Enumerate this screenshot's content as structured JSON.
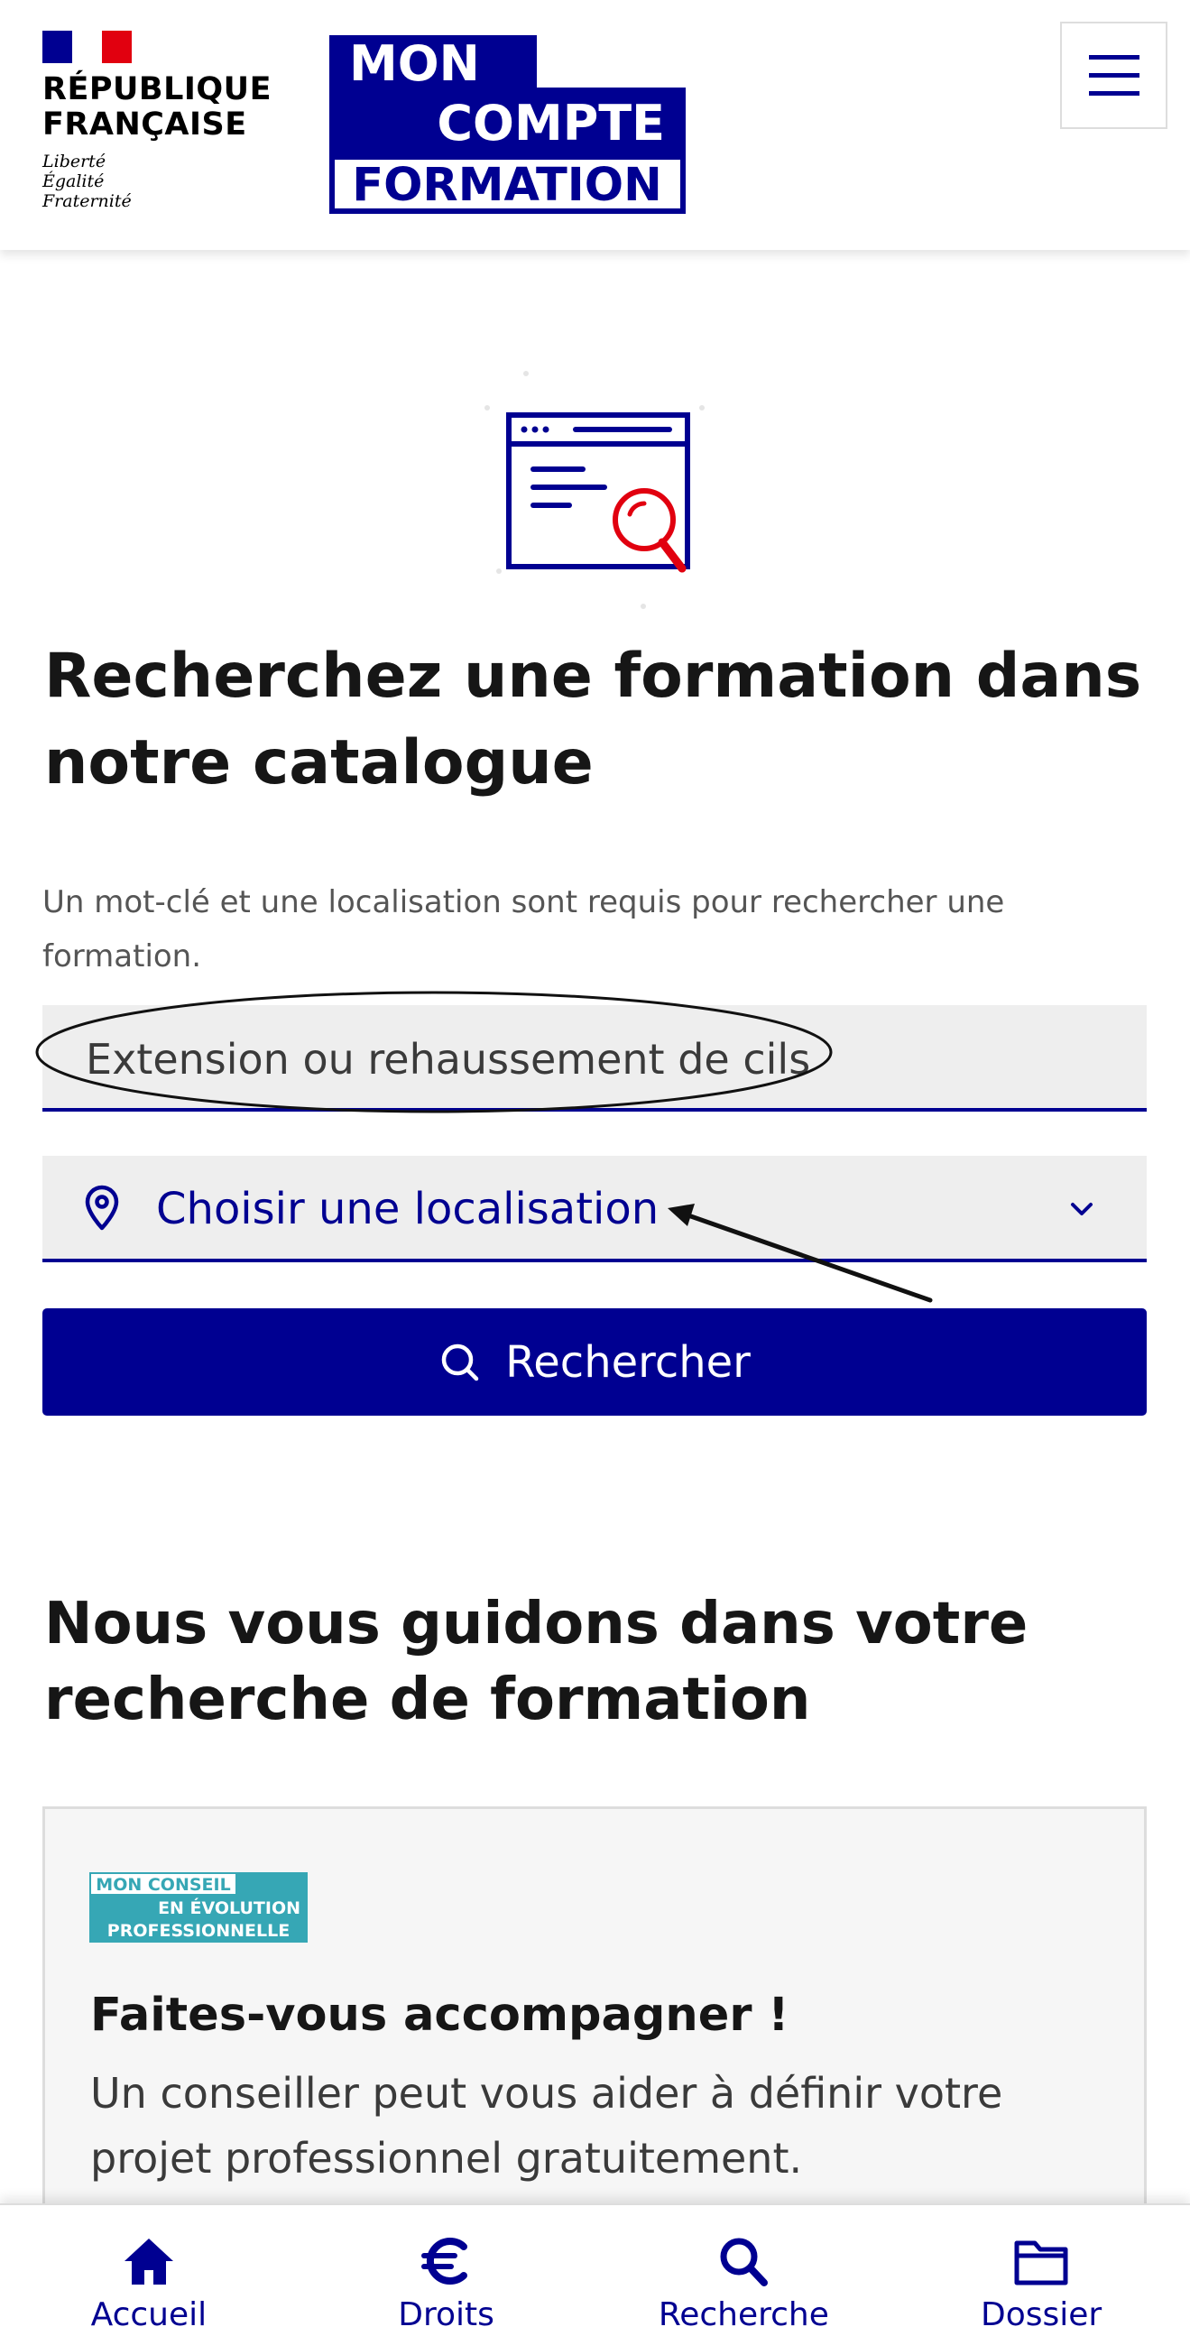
{
  "header": {
    "republic_line1": "RÉPUBLIQUE",
    "republic_line2": "FRANÇAISE",
    "motto_1": "Liberté",
    "motto_2": "Égalité",
    "motto_3": "Fraternité",
    "app_logo_line1": "MON",
    "app_logo_line2": "COMPTE",
    "app_logo_line3": "FORMATION",
    "menu_icon": "hamburger-icon"
  },
  "search": {
    "title": "Recherchez une formation dans notre catalogue",
    "hint": "Un mot-clé et une localisation sont requis pour rechercher une formation.",
    "keyword_value": "Extension ou rehaussement de cils",
    "location_placeholder": "Choisir une localisation",
    "location_icon": "map-pin-icon",
    "dropdown_icon": "chevron-down-icon",
    "button_label": "Rechercher",
    "button_icon": "search-icon"
  },
  "guide": {
    "title": "Nous vous guidons dans votre recherche de formation",
    "card_logo_line1": "MON CONSEIL",
    "card_logo_line2": "EN ÉVOLUTION",
    "card_logo_line3": "PROFESSIONNELLE",
    "card_title": "Faites-vous accompagner !",
    "card_desc": "Un conseiller peut vous aider à définir votre projet professionnel gratuitement."
  },
  "bottom_nav": {
    "items": [
      {
        "label": "Accueil",
        "icon": "home-icon"
      },
      {
        "label": "Droits",
        "icon": "euro-icon"
      },
      {
        "label": "Recherche",
        "icon": "search-icon"
      },
      {
        "label": "Dossier",
        "icon": "folder-icon"
      }
    ]
  },
  "colors": {
    "primary": "#000091",
    "accent_red": "#e1000f",
    "teal": "#36a7b5",
    "field_bg": "#eeeeee"
  }
}
